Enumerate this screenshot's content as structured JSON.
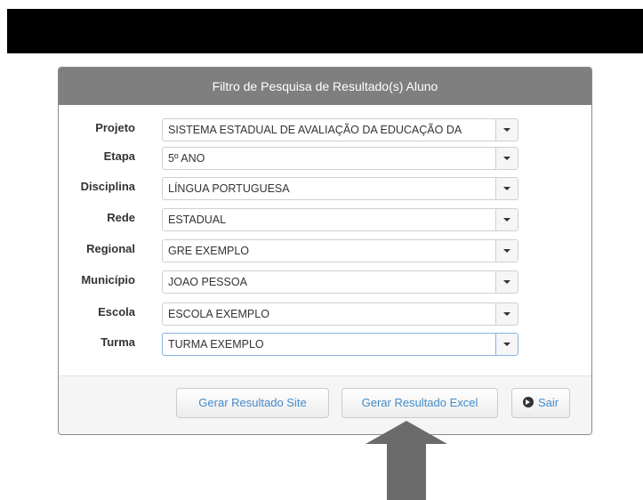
{
  "panel": {
    "title": "Filtro de Pesquisa de Resultado(s) Aluno"
  },
  "fields": [
    {
      "label": "Projeto",
      "value": "SISTEMA ESTADUAL DE AVALIAÇÃO DA EDUCAÇÃO DA"
    },
    {
      "label": "Etapa",
      "value": "5º ANO"
    },
    {
      "label": "Disciplina",
      "value": "LÍNGUA PORTUGUESA"
    },
    {
      "label": "Rede",
      "value": "ESTADUAL"
    },
    {
      "label": "Regional",
      "value": "GRE EXEMPLO"
    },
    {
      "label": "Município",
      "value": "JOAO PESSOA"
    },
    {
      "label": "Escola",
      "value": "ESCOLA EXEMPLO"
    },
    {
      "label": "Turma",
      "value": "TURMA EXEMPLO"
    }
  ],
  "buttons": {
    "gerar_site": "Gerar Resultado Site",
    "gerar_excel": "Gerar Resultado Excel",
    "sair": "Sair"
  },
  "colors": {
    "heading": "#7f7f7f",
    "button_text": "#428bca",
    "arrow": "#6b6b6b"
  }
}
